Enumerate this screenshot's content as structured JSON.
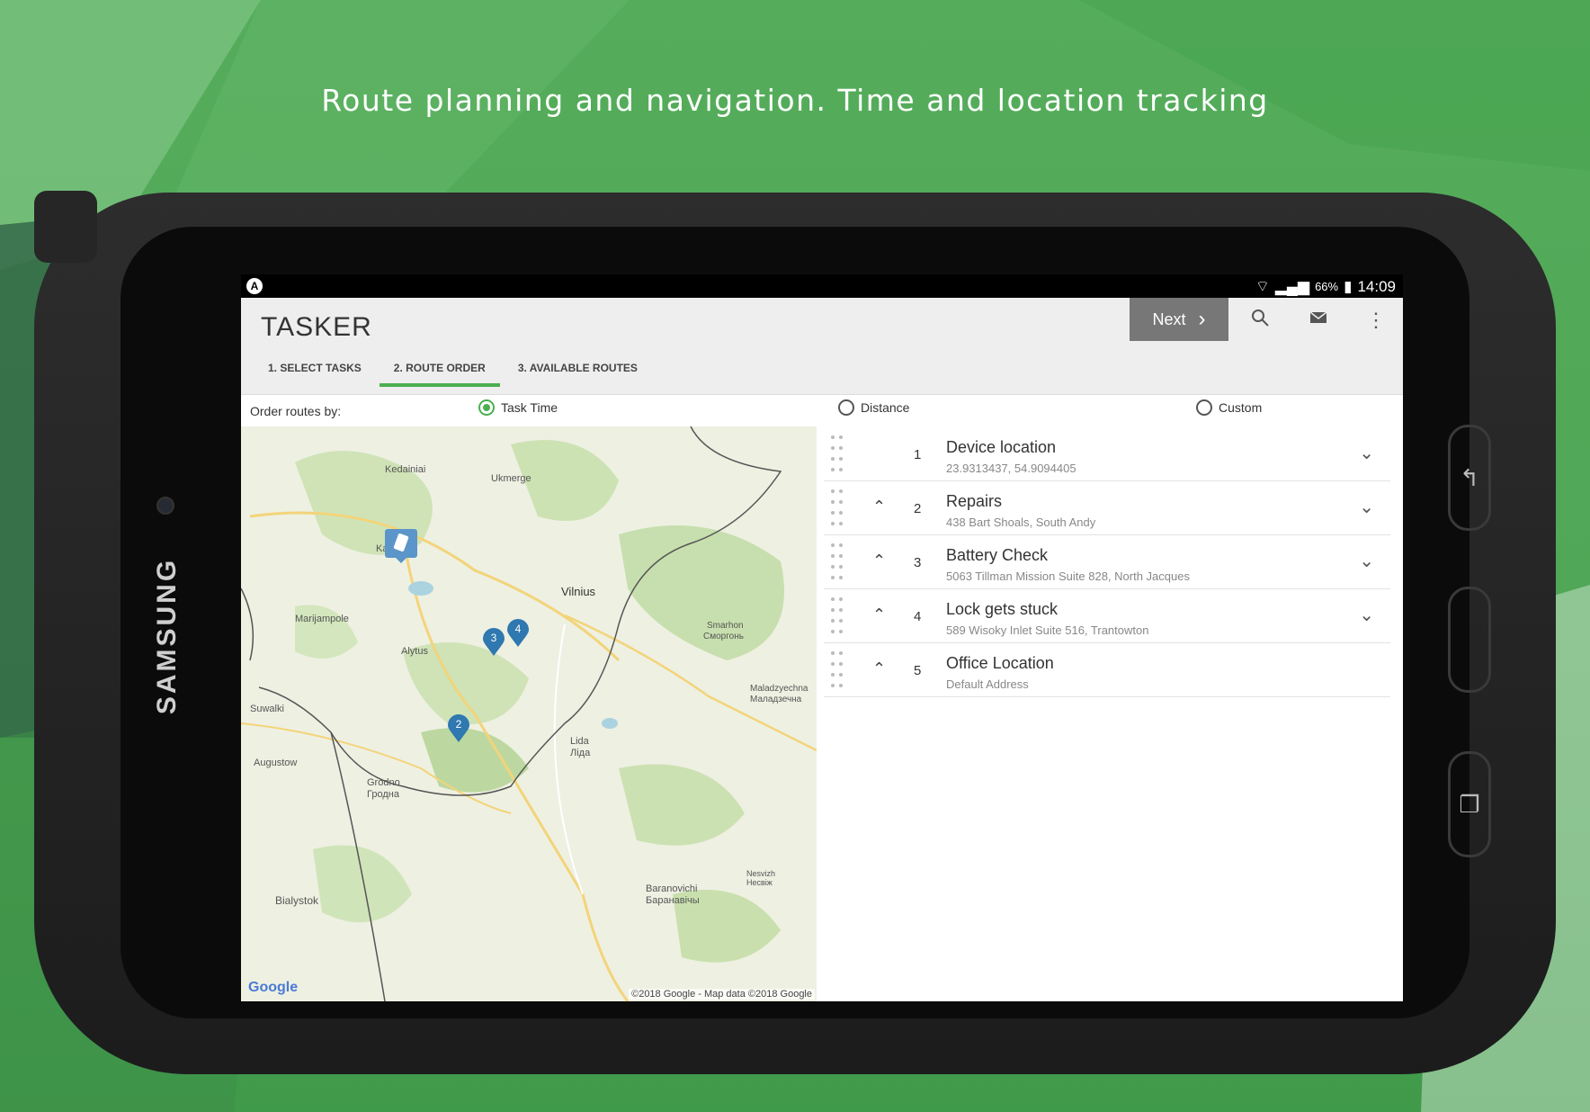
{
  "headline": "Route planning and navigation. Time and location tracking",
  "device": {
    "brand": "SAMSUNG"
  },
  "status_bar": {
    "battery": "66%",
    "time": "14:09"
  },
  "app": {
    "logo": "TASKER",
    "next_label": "Next",
    "tabs": [
      {
        "label": "1. SELECT TASKS",
        "active": false
      },
      {
        "label": "2. ROUTE ORDER",
        "active": true
      },
      {
        "label": "3. AVAILABLE ROUTES",
        "active": false
      }
    ]
  },
  "order_by": {
    "label": "Order routes by:",
    "options": [
      {
        "label": "Task Time",
        "checked": true
      },
      {
        "label": "Distance",
        "checked": false
      },
      {
        "label": "Custom",
        "checked": false
      }
    ]
  },
  "map": {
    "labels": [
      "Kedainiai",
      "Ukmerge",
      "Kaunas",
      "Vilnius",
      "Marijampole",
      "Alytus",
      "Smarhon",
      "Сморгонь",
      "Maladzyechna",
      "Маладзечна",
      "Suwalki",
      "Augustow",
      "Lida",
      "Ліда",
      "Grodno",
      "Гродна",
      "Bialystok",
      "Baranovichi",
      "Баранавічы",
      "Nesvizh",
      "Несвіж"
    ],
    "markers": [
      "2",
      "3",
      "4"
    ],
    "google": "Google",
    "copyright": "©2018 Google - Map data ©2018 Google"
  },
  "stops": [
    {
      "num": "1",
      "title": "Device location",
      "sub": "23.9313437, 54.9094405",
      "up": false,
      "chev": true
    },
    {
      "num": "2",
      "title": "Repairs",
      "sub": "438 Bart Shoals, South Andy",
      "up": true,
      "chev": true
    },
    {
      "num": "3",
      "title": "Battery Check",
      "sub": "5063 Tillman Mission Suite 828, North Jacques",
      "up": true,
      "chev": true
    },
    {
      "num": "4",
      "title": "Lock gets stuck",
      "sub": "589 Wisoky Inlet Suite 516, Trantowton",
      "up": true,
      "chev": true
    },
    {
      "num": "5",
      "title": "Office Location",
      "sub": "Default Address",
      "up": true,
      "chev": false
    }
  ]
}
